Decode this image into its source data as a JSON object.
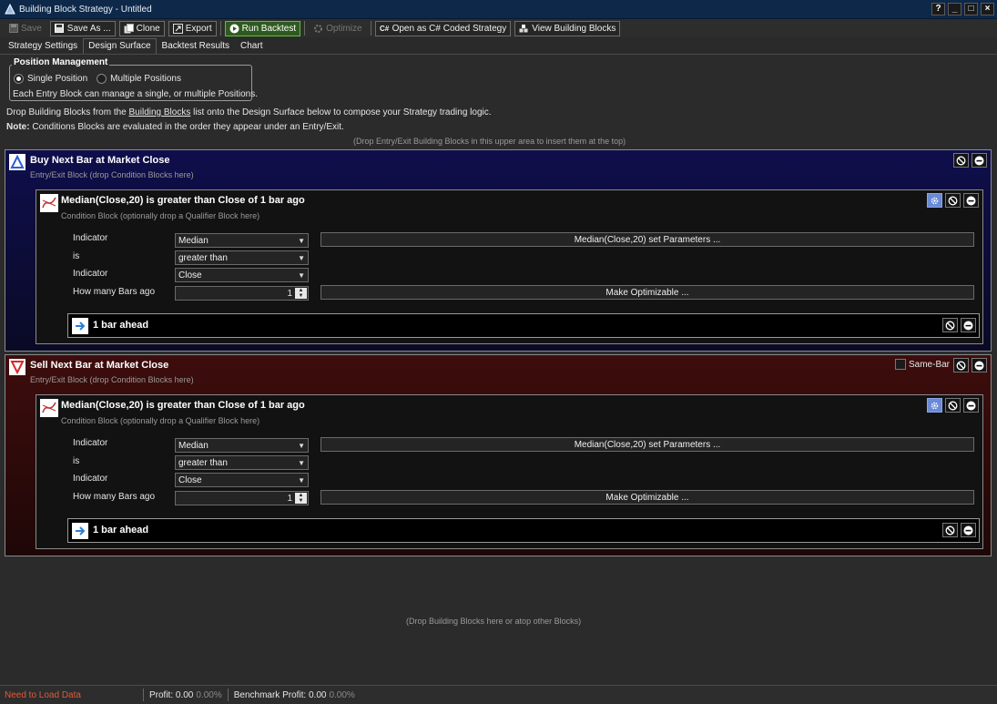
{
  "window": {
    "title": "Building Block Strategy - Untitled",
    "buttons": [
      "?",
      "_",
      "□",
      "×"
    ]
  },
  "toolbar": {
    "save": "Save",
    "save_as": "Save As ...",
    "clone": "Clone",
    "export": "Export",
    "run_backtest": "Run Backtest",
    "optimize": "Optimize",
    "open_coded": "Open as C# Coded Strategy",
    "view_blocks": "View Building Blocks"
  },
  "tabs": [
    {
      "label": "Strategy Settings",
      "active": false
    },
    {
      "label": "Design Surface",
      "active": true
    },
    {
      "label": "Backtest Results",
      "active": false
    },
    {
      "label": "Chart",
      "active": false
    }
  ],
  "position_management": {
    "legend": "Position Management",
    "options": [
      {
        "label": "Single Position",
        "selected": true
      },
      {
        "label": "Multiple Positions",
        "selected": false
      }
    ],
    "description": "Each Entry Block can manage a single, or multiple Positions."
  },
  "instructions": {
    "line1_prefix": "Drop Building Blocks from the ",
    "line1_link": "Building Blocks",
    "line1_suffix": " list onto the Design Surface below to compose your Strategy trading logic.",
    "note_label": "Note:",
    "note_text": " Conditions Blocks are evaluated in the order they appear under an Entry/Exit."
  },
  "top_hint": "(Drop Entry/Exit Building Blocks in this upper area to insert them at the top)",
  "bottom_hint": "(Drop Building Blocks here or atop other Blocks)",
  "blocks": [
    {
      "kind": "buy",
      "title": "Buy Next Bar at Market Close",
      "subtitle": "Entry/Exit Block (drop Condition Blocks here)",
      "condition": {
        "title": "Median(Close,20) is greater than Close of 1 bar ago",
        "subtitle": "Condition Block (optionally drop a Qualifier Block here)",
        "labels": [
          "Indicator",
          "is",
          "Indicator",
          "How many Bars ago"
        ],
        "indicator1": "Median",
        "comparison": "greater than",
        "indicator2": "Close",
        "bars_ago": "1",
        "params_button": "Median(Close,20) set Parameters ...",
        "optimizable_button": "Make Optimizable ..."
      },
      "qualifier": {
        "title": "1 bar ahead"
      }
    },
    {
      "kind": "sell",
      "title": "Sell Next Bar at Market Close",
      "subtitle": "Entry/Exit Block (drop Condition Blocks here)",
      "same_bar": "Same-Bar",
      "condition": {
        "title": "Median(Close,20) is greater than Close of 1 bar ago",
        "subtitle": "Condition Block (optionally drop a Qualifier Block here)",
        "labels": [
          "Indicator",
          "is",
          "Indicator",
          "How many Bars ago"
        ],
        "indicator1": "Median",
        "comparison": "greater than",
        "indicator2": "Close",
        "bars_ago": "1",
        "params_button": "Median(Close,20) set Parameters ...",
        "optimizable_button": "Make Optimizable ..."
      },
      "qualifier": {
        "title": "1 bar ahead"
      }
    }
  ],
  "status": {
    "load": "Need to Load Data",
    "profit_label": "Profit:",
    "profit_value": "0.00",
    "profit_pct": "0.00%",
    "bench_label": "Benchmark Profit:",
    "bench_value": "0.00",
    "bench_pct": "0.00%"
  },
  "colors": {
    "buy_block": "#0f0e4c",
    "sell_block": "#3e0d0d",
    "run_button": "#2f5a1f",
    "title_bar": "#0e2849",
    "status_warning": "#e05a3a"
  }
}
